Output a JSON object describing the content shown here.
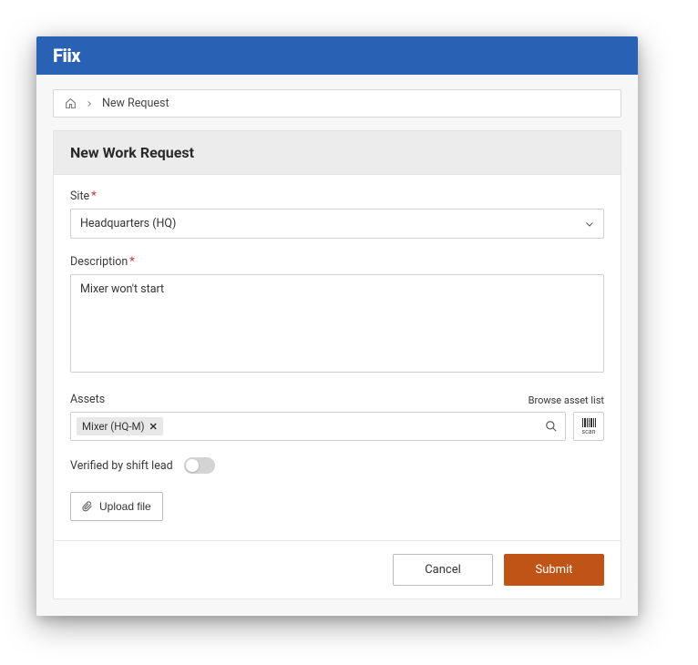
{
  "brand": "Fiix",
  "breadcrumb": {
    "current": "New Request"
  },
  "page_title": "New Work Request",
  "form": {
    "site_label": "Site",
    "site_value": "Headquarters (HQ)",
    "description_label": "Description",
    "description_value": "Mixer won't start",
    "assets_label": "Assets",
    "browse_assets_label": "Browse asset list",
    "asset_tag": "Mixer (HQ-M)",
    "scan_label": "scan",
    "verified_label": "Verified by shift lead",
    "verified_value": false,
    "upload_label": "Upload file"
  },
  "actions": {
    "cancel": "Cancel",
    "submit": "Submit"
  }
}
